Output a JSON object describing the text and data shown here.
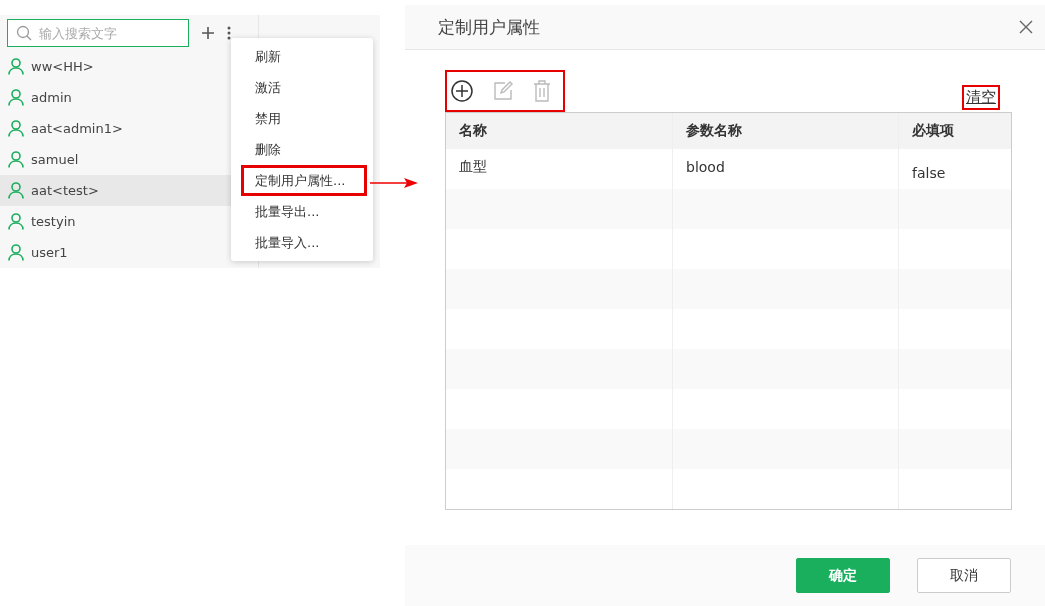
{
  "sidebar": {
    "search": {
      "placeholder": "输入搜索文字"
    },
    "users": [
      {
        "name": "ww<HH>",
        "selected": false
      },
      {
        "name": "admin",
        "selected": false
      },
      {
        "name": "aat<admin1>",
        "selected": false
      },
      {
        "name": "samuel",
        "selected": false
      },
      {
        "name": "aat<test>",
        "selected": true
      },
      {
        "name": "testyin",
        "selected": false
      },
      {
        "name": "user1",
        "selected": false
      }
    ]
  },
  "context_menu": {
    "items": [
      {
        "label": "刷新",
        "annotated": false
      },
      {
        "label": "激活",
        "annotated": false
      },
      {
        "label": "禁用",
        "annotated": false
      },
      {
        "label": "删除",
        "annotated": false
      },
      {
        "label": "定制用户属性...",
        "annotated": true
      },
      {
        "label": "批量导出...",
        "annotated": false
      },
      {
        "label": "批量导入...",
        "annotated": false
      }
    ]
  },
  "dialog": {
    "title": "定制用户属性",
    "toolbar": {
      "annotated": true,
      "buttons": [
        {
          "kind": "add",
          "disabled": false
        },
        {
          "kind": "edit",
          "disabled": true
        },
        {
          "kind": "delete",
          "disabled": true
        }
      ]
    },
    "clear_link": {
      "label": "清空",
      "annotated": true
    },
    "table": {
      "columns": [
        "名称",
        "参数名称",
        "必填项"
      ],
      "rows": [
        {
          "cells": [
            "血型",
            "blood",
            "false"
          ]
        }
      ]
    },
    "buttons": [
      {
        "label": "确定",
        "kind": "primary"
      },
      {
        "label": "取消",
        "kind": "default"
      }
    ]
  }
}
